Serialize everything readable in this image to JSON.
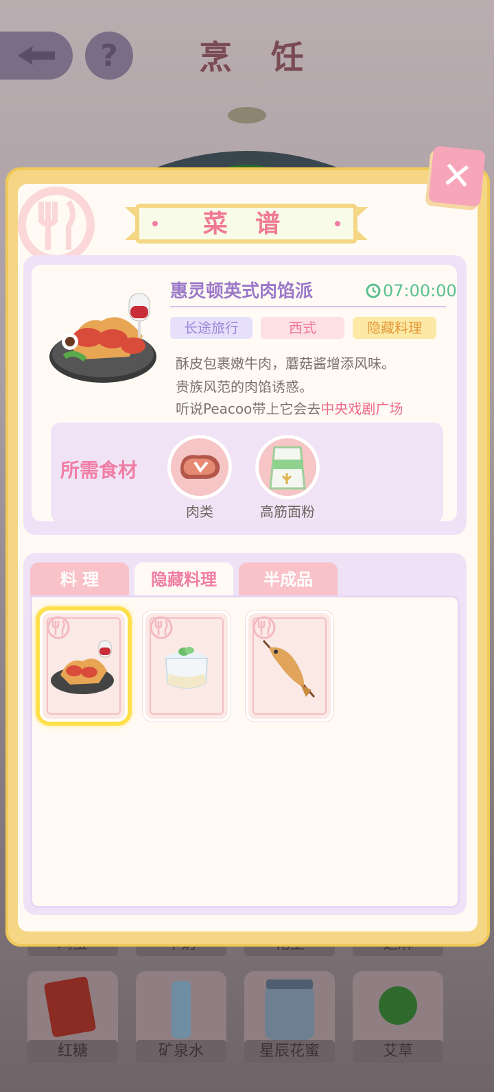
{
  "header": {
    "title": "烹 饪"
  },
  "background": {
    "ingredient_labels_row1": [
      "鸡蛋",
      "牛奶",
      "花生",
      "芝麻"
    ],
    "ingredient_labels_row2": [
      "红糖",
      "矿泉水",
      "星辰花蜜",
      "艾草"
    ]
  },
  "modal": {
    "title": "菜 谱",
    "recipe": {
      "name": "惠灵顿英式肉馅派",
      "time": "07:00:00",
      "tags": [
        "长途旅行",
        "西式",
        "隐藏料理"
      ],
      "description_lines": [
        "酥皮包裹嫩牛肉，蘑菇酱增添风味。",
        "贵族风范的肉馅诱惑。"
      ],
      "hint_prefix": "听说Peacoo带上它会去",
      "hint_place": "中央戏剧广场"
    },
    "ingredients": {
      "title": "所需食材",
      "items": [
        "肉类",
        "高筋面粉"
      ]
    },
    "tabs": [
      "料 理",
      "隐藏料理",
      "半成品"
    ],
    "active_tab": 1,
    "items": [
      "beef-wellington",
      "milk-jar",
      "grilled-fish"
    ]
  },
  "colors": {
    "accent": "#f07ea4",
    "purple": "#9b78c8",
    "timer": "#57c08e",
    "frame": "#f4d684"
  }
}
